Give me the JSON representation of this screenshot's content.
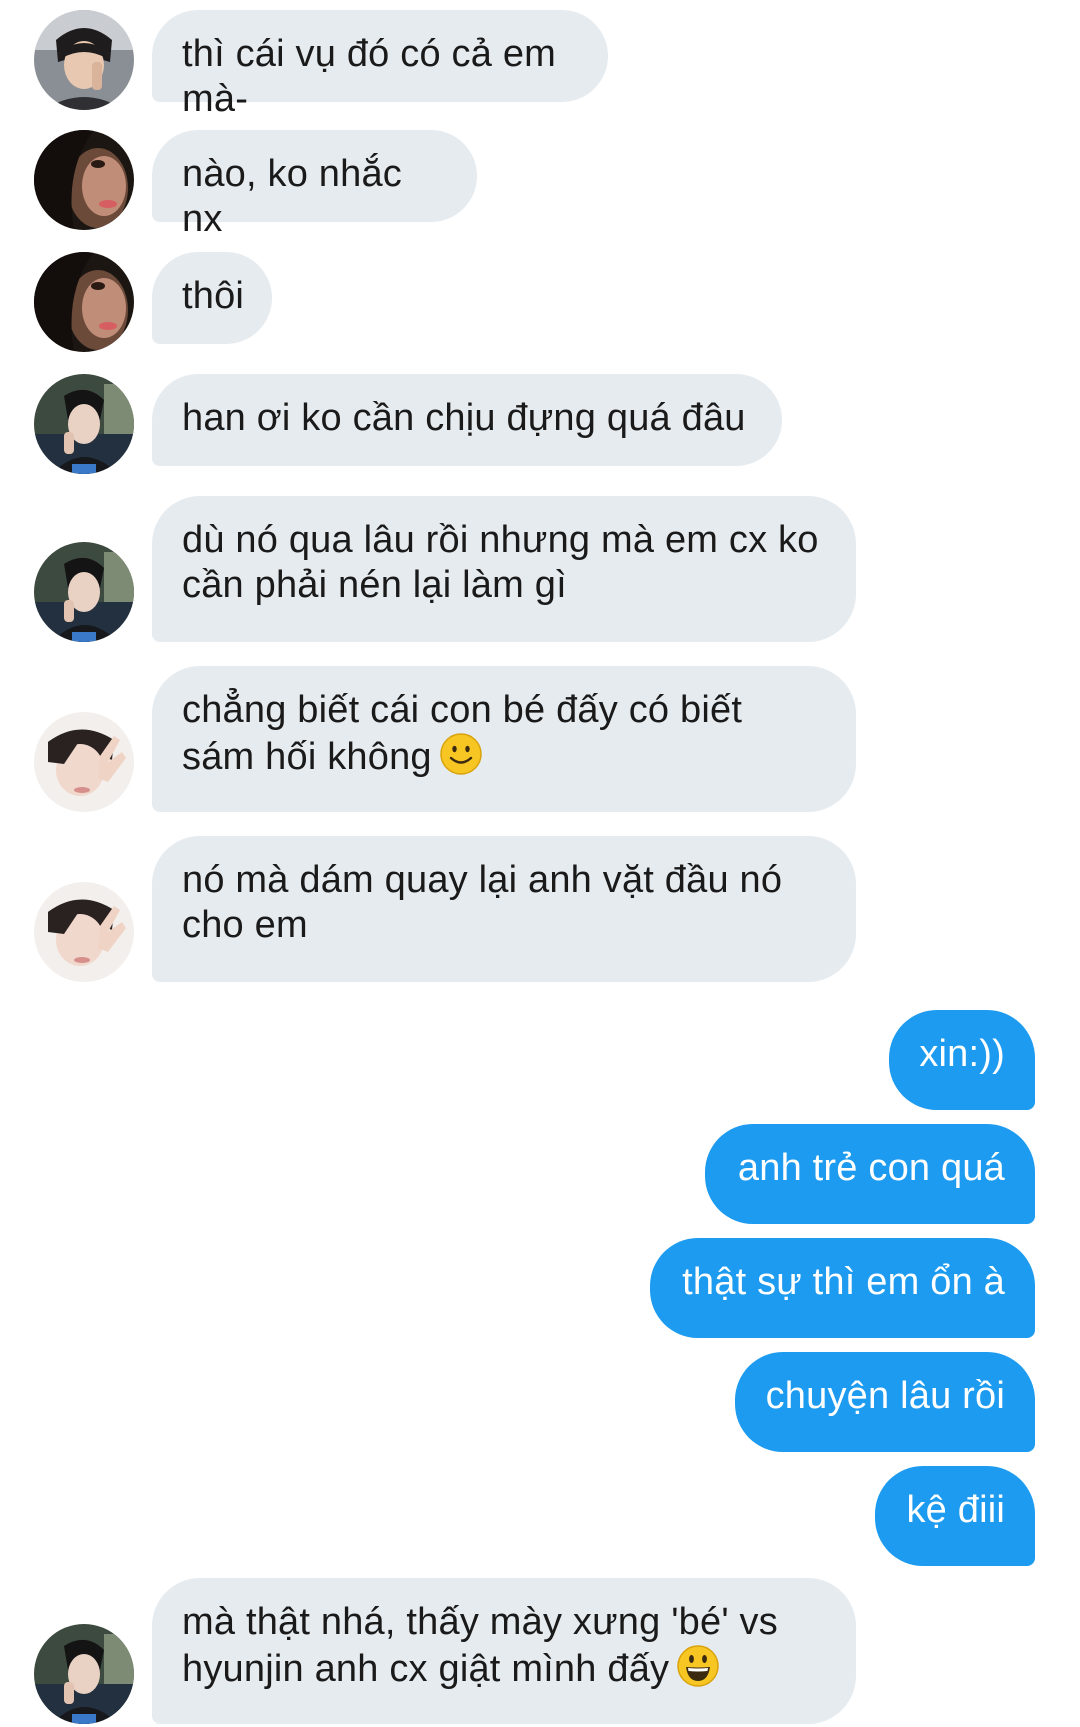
{
  "messages": [
    {
      "side": "in",
      "avatar": "avatar-1",
      "text": "thì cái vụ đó có cả em mà-"
    },
    {
      "side": "in",
      "avatar": "avatar-2",
      "text": "nào, ko nhắc nx"
    },
    {
      "side": "in",
      "avatar": "avatar-2",
      "text": "thôi"
    },
    {
      "side": "in",
      "avatar": "avatar-3",
      "text": "han ơi ko cần chịu đựng quá đâu"
    },
    {
      "side": "in",
      "avatar": "avatar-3",
      "line1": "dù nó qua lâu rồi nhưng mà em cx ko",
      "line2": "cần phải nén lại làm gì"
    },
    {
      "side": "in",
      "avatar": "avatar-4",
      "line1": "chẳng biết cái con bé đấy có biết",
      "line2": "sám hối không",
      "emoji": "slightly-smiling-face-emoji"
    },
    {
      "side": "in",
      "avatar": "avatar-4",
      "line1": "nó mà dám quay lại anh vặt đầu nó",
      "line2": "cho em"
    },
    {
      "side": "out",
      "text": "xin:))"
    },
    {
      "side": "out",
      "text": "anh trẻ con quá"
    },
    {
      "side": "out",
      "text": "thật sự thì em ổn à"
    },
    {
      "side": "out",
      "text": "chuyện lâu rồi"
    },
    {
      "side": "out",
      "text": "kệ điii"
    },
    {
      "side": "in",
      "avatar": "avatar-3",
      "line1": "mà thật nhá, thấy mày xưng 'bé' vs",
      "line2": "hyunjin anh cx giật mình đấy",
      "emoji": "grinning-face-emoji"
    }
  ],
  "colors": {
    "incoming_bubble": "#e6ebef",
    "outgoing_bubble": "#1d9bf0",
    "incoming_text": "#1a1a1a",
    "outgoing_text": "#ffffff",
    "emoji_yellow": "#f7c623"
  }
}
